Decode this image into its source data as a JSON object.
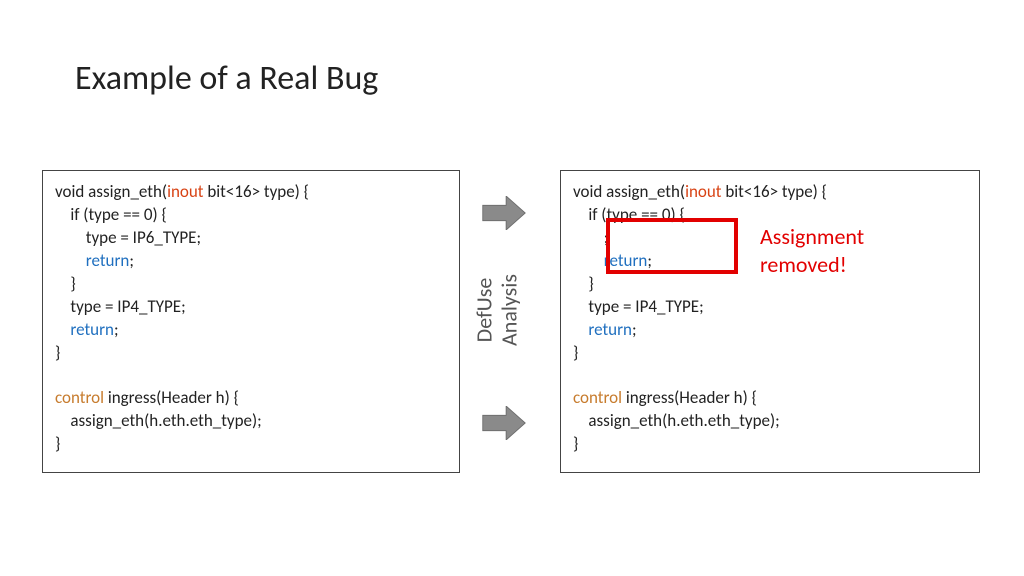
{
  "title": "Example of a Real Bug",
  "defuse": {
    "line1": "DefUse",
    "line2": "Analysis"
  },
  "callout": {
    "line1": "Assignment",
    "line2": "removed!"
  },
  "kw": {
    "inout": "inout",
    "return": "return",
    "control": "control"
  },
  "left": {
    "l1a": "void assign_eth(",
    "l1b": " bit<16> type) {",
    "l2": "    if (type == 0) {",
    "l3": "        type = IP6_TYPE;",
    "l4a": "        ",
    "l4b": ";",
    "l5": "    }",
    "l6": "    type = IP4_TYPE;",
    "l7a": "    ",
    "l7b": ";",
    "l8": "}",
    "l9": "",
    "l10a": " ingress(Header h) {",
    "l11": "    assign_eth(h.eth.eth_type);",
    "l12": "}"
  },
  "right": {
    "l1a": "void assign_eth(",
    "l1b": " bit<16> type) {",
    "l2": "    if (type == 0) {",
    "l3": "        ;",
    "l4a": "        ",
    "l4b": ";",
    "l5": "    }",
    "l6": "    type = IP4_TYPE;",
    "l7a": "    ",
    "l7b": ";",
    "l8": "}",
    "l9": "",
    "l10a": " ingress(Header h) {",
    "l11": "    assign_eth(h.eth.eth_type);",
    "l12": "}"
  }
}
